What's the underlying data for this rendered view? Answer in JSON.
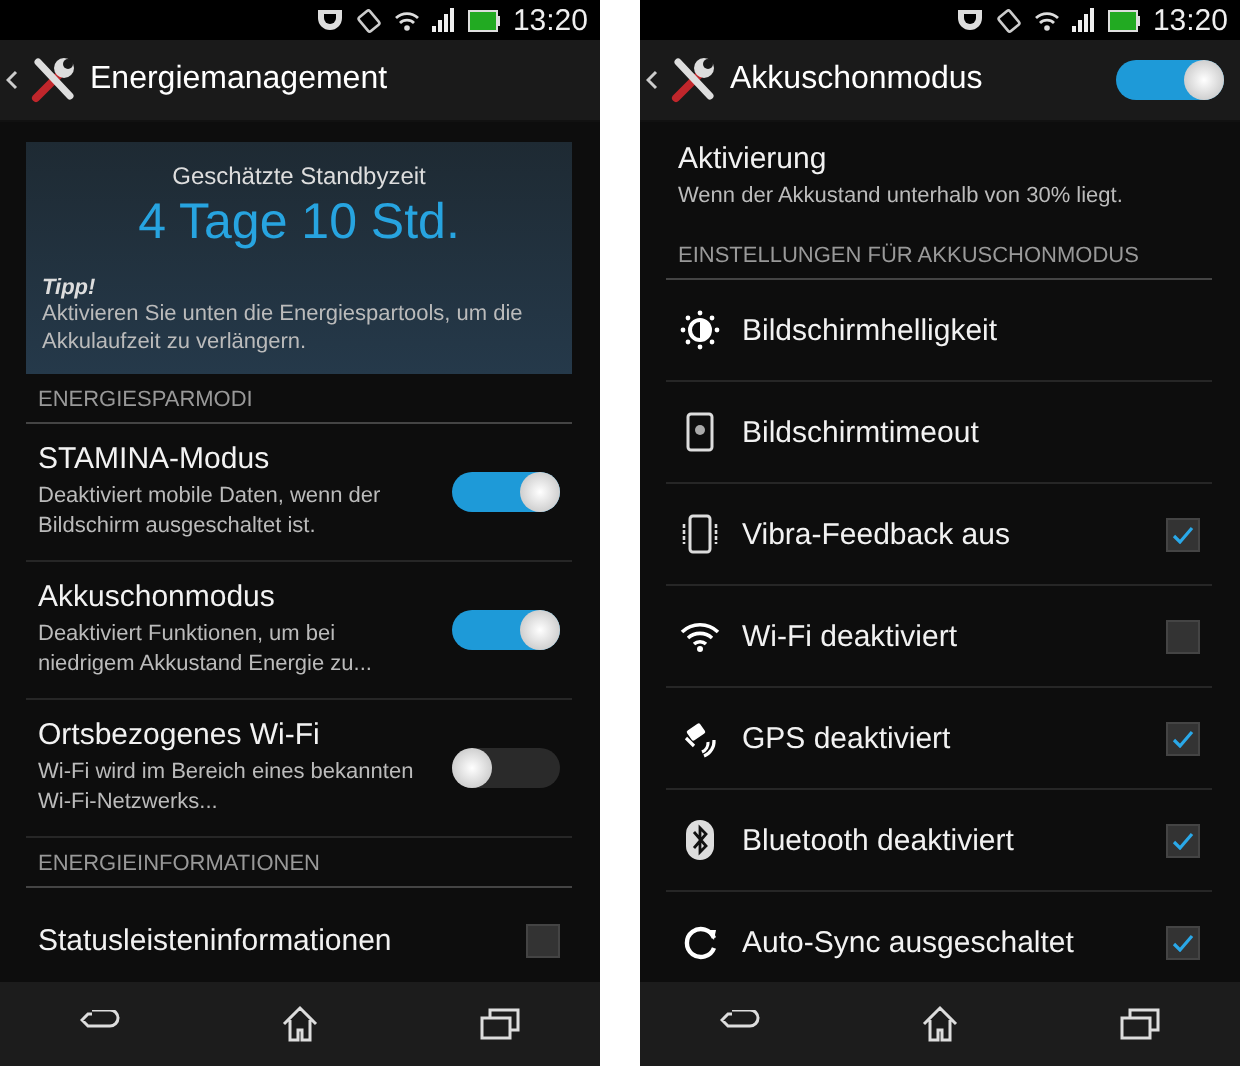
{
  "phones": [
    {
      "status_bar": {
        "time": "13:20"
      },
      "header": {
        "title": "Energiemanagement"
      },
      "items": [
        {
          "kind": "estimate_card",
          "label": "Geschätzte Standbyzeit",
          "value": "4 Tage 10 Std.",
          "tip_title": "Tipp!",
          "tip_text": "Aktivieren Sie unten die Energiespartools, um die Akkulaufzeit zu verlängern."
        },
        {
          "kind": "section_header",
          "title": "ENERGIESPARMODI"
        },
        {
          "kind": "toggle_row",
          "title": "STAMINA-Modus",
          "subtitle": "Deaktiviert mobile Daten, wenn der Bildschirm ausgeschaltet ist.",
          "on": true
        },
        {
          "kind": "toggle_row",
          "title": "Akkuschonmodus",
          "subtitle": "Deaktiviert Funktionen, um bei niedrigem Akkustand Energie zu...",
          "on": true
        },
        {
          "kind": "toggle_row",
          "title": "Ortsbezogenes Wi-Fi",
          "subtitle": "Wi-Fi wird im Bereich eines bekannten Wi-Fi-Netzwerks...",
          "on": false
        },
        {
          "kind": "section_header",
          "title": "ENERGIEINFORMATIONEN"
        },
        {
          "kind": "check_row",
          "title": "Statusleisteninformationen",
          "checked": false
        }
      ]
    },
    {
      "status_bar": {
        "time": "13:20"
      },
      "header": {
        "title": "Akkuschonmodus",
        "switch_on": true
      },
      "items": [
        {
          "kind": "info_row",
          "title": "Aktivierung",
          "subtitle": "Wenn der Akkustand unterhalb von 30% liegt."
        },
        {
          "kind": "section_header",
          "title": "EINSTELLUNGEN FÜR AKKUSCHONMODUS"
        },
        {
          "kind": "icon_row",
          "title": "Bildschirmhelligkeit"
        },
        {
          "kind": "icon_row",
          "title": "Bildschirmtimeout"
        },
        {
          "kind": "icon_check_row",
          "title": "Vibra-Feedback aus",
          "checked": true
        },
        {
          "kind": "icon_check_row",
          "title": "Wi-Fi deaktiviert",
          "checked": false
        },
        {
          "kind": "icon_check_row",
          "title": "GPS deaktiviert",
          "checked": true
        },
        {
          "kind": "icon_check_row",
          "title": "Bluetooth deaktiviert",
          "checked": true
        },
        {
          "kind": "icon_check_row",
          "title": "Auto-Sync ausgeschaltet",
          "checked": true
        }
      ]
    }
  ]
}
